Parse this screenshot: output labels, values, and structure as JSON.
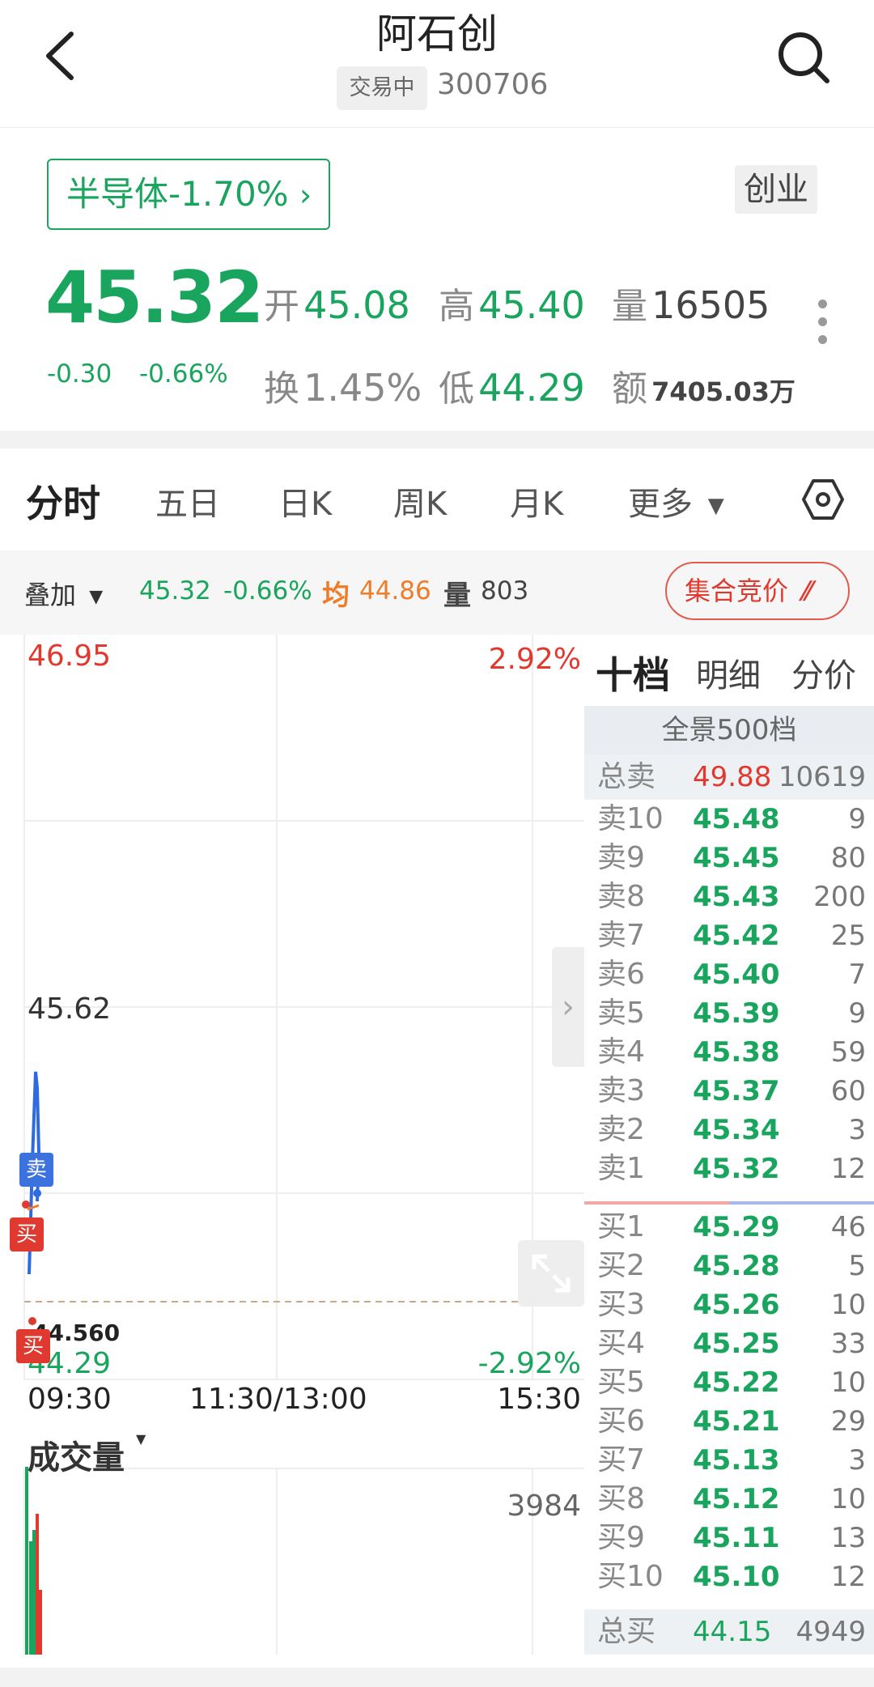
{
  "header": {
    "title": "阿石创",
    "status": "交易中",
    "code": "300706"
  },
  "sector": {
    "label": "半导体-1.70% ",
    "board": "创业"
  },
  "quote": {
    "price": "45.32",
    "change": "-0.30",
    "change_pct": "-0.66%",
    "open_label": "开",
    "open": "45.08",
    "high_label": "高",
    "high": "45.40",
    "vol_label": "量",
    "vol": "16505",
    "turnover_label": "换",
    "turnover": "1.45%",
    "low_label": "低",
    "low": "44.29",
    "amount_label": "额",
    "amount": "7405.03万"
  },
  "tabs": [
    "分时",
    "五日",
    "日K",
    "周K",
    "月K",
    "更多"
  ],
  "overlay": {
    "label": "叠加",
    "price": "45.32",
    "pct": "-0.66%",
    "avg_label": "均",
    "avg": "44.86",
    "vol_label": "量",
    "vol": "803",
    "auction": "集合竞价"
  },
  "chart": {
    "y_top": "46.95",
    "y_top_pct": "2.92%",
    "y_mid": "45.62",
    "y_bottom": "44.29",
    "y_bottom_pct": "-2.92%",
    "low_marker": "44.560",
    "t_start": "09:30",
    "t_mid": "11:30/13:00",
    "t_end": "15:30",
    "vol_title": "成交量",
    "vol_max": "3984",
    "marker_sell": "卖",
    "marker_buy": "买",
    "colors": {
      "price_line": "#2f6be0",
      "up": "#e03a30",
      "down": "#1aa55e"
    }
  },
  "book": {
    "tabs": [
      "十档",
      "明细",
      "分价"
    ],
    "panorama": "全景500档",
    "total_sell": {
      "label": "总卖",
      "price": "49.88",
      "vol": "10619"
    },
    "asks": [
      {
        "label": "卖10",
        "price": "45.48",
        "vol": "9"
      },
      {
        "label": "卖9",
        "price": "45.45",
        "vol": "80"
      },
      {
        "label": "卖8",
        "price": "45.43",
        "vol": "200"
      },
      {
        "label": "卖7",
        "price": "45.42",
        "vol": "25"
      },
      {
        "label": "卖6",
        "price": "45.40",
        "vol": "7"
      },
      {
        "label": "卖5",
        "price": "45.39",
        "vol": "9"
      },
      {
        "label": "卖4",
        "price": "45.38",
        "vol": "59"
      },
      {
        "label": "卖3",
        "price": "45.37",
        "vol": "60"
      },
      {
        "label": "卖2",
        "price": "45.34",
        "vol": "3"
      },
      {
        "label": "卖1",
        "price": "45.32",
        "vol": "12"
      }
    ],
    "bids": [
      {
        "label": "买1",
        "price": "45.29",
        "vol": "46"
      },
      {
        "label": "买2",
        "price": "45.28",
        "vol": "5"
      },
      {
        "label": "买3",
        "price": "45.26",
        "vol": "10"
      },
      {
        "label": "买4",
        "price": "45.25",
        "vol": "33"
      },
      {
        "label": "买5",
        "price": "45.22",
        "vol": "10"
      },
      {
        "label": "买6",
        "price": "45.21",
        "vol": "29"
      },
      {
        "label": "买7",
        "price": "45.13",
        "vol": "3"
      },
      {
        "label": "买8",
        "price": "45.12",
        "vol": "10"
      },
      {
        "label": "买9",
        "price": "45.11",
        "vol": "13"
      },
      {
        "label": "买10",
        "price": "45.10",
        "vol": "12"
      }
    ],
    "total_buy": {
      "label": "总买",
      "price": "44.15",
      "vol": "4949"
    }
  }
}
